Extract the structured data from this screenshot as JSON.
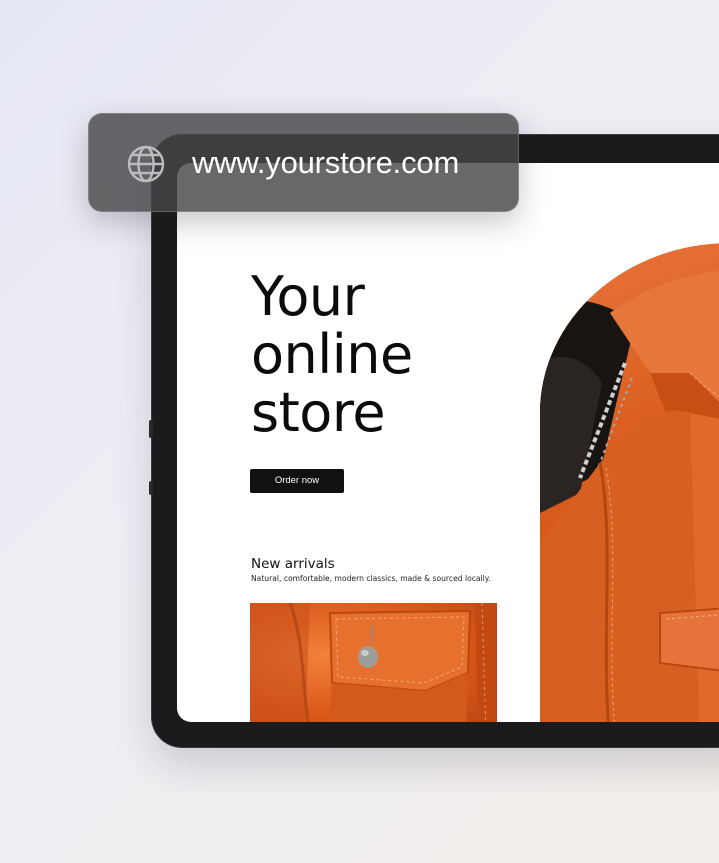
{
  "url_bar": {
    "url": "www.yourstore.com",
    "icon": "globe-icon"
  },
  "hero": {
    "title_lines": [
      "Your",
      "online",
      "store"
    ],
    "cta_label": "Order now"
  },
  "new_arrivals": {
    "title": "New arrivals",
    "subtitle": "Natural, comfortable, modern classics, made & sourced locally."
  },
  "colors": {
    "accent_orange": "#e0642a",
    "button_bg": "#111114",
    "text_dark": "#0b0b0b",
    "url_pill_bg": "#484648"
  }
}
